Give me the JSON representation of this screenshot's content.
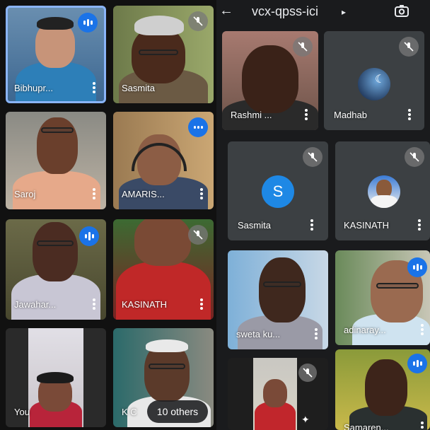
{
  "header": {
    "meeting_code": "vcx-qpss-ici",
    "code_arrow": "▸",
    "back": "←"
  },
  "tiles": {
    "bibhupr": "Bibhupr...",
    "sasmita_left": "Sasmita",
    "saroj": "Saroj",
    "amaris": "AMARIS...",
    "jawahar": "Jawahar...",
    "kasinath_left": "KASINATH",
    "you": "You",
    "kc": "K C",
    "rashmi": "Rashmi ...",
    "madhab": "Madhab",
    "sasmita_right": "Sasmita",
    "sasmita_initial": "S",
    "kasinath_right": "KASINATH",
    "sweta": "sweta ku...",
    "adinaray": "adinaray...",
    "samaren": "Samaren..."
  },
  "others": {
    "label": "10 others"
  },
  "colors": {
    "accent_blue": "#1a73e8",
    "active_border": "#8ab4f8"
  }
}
